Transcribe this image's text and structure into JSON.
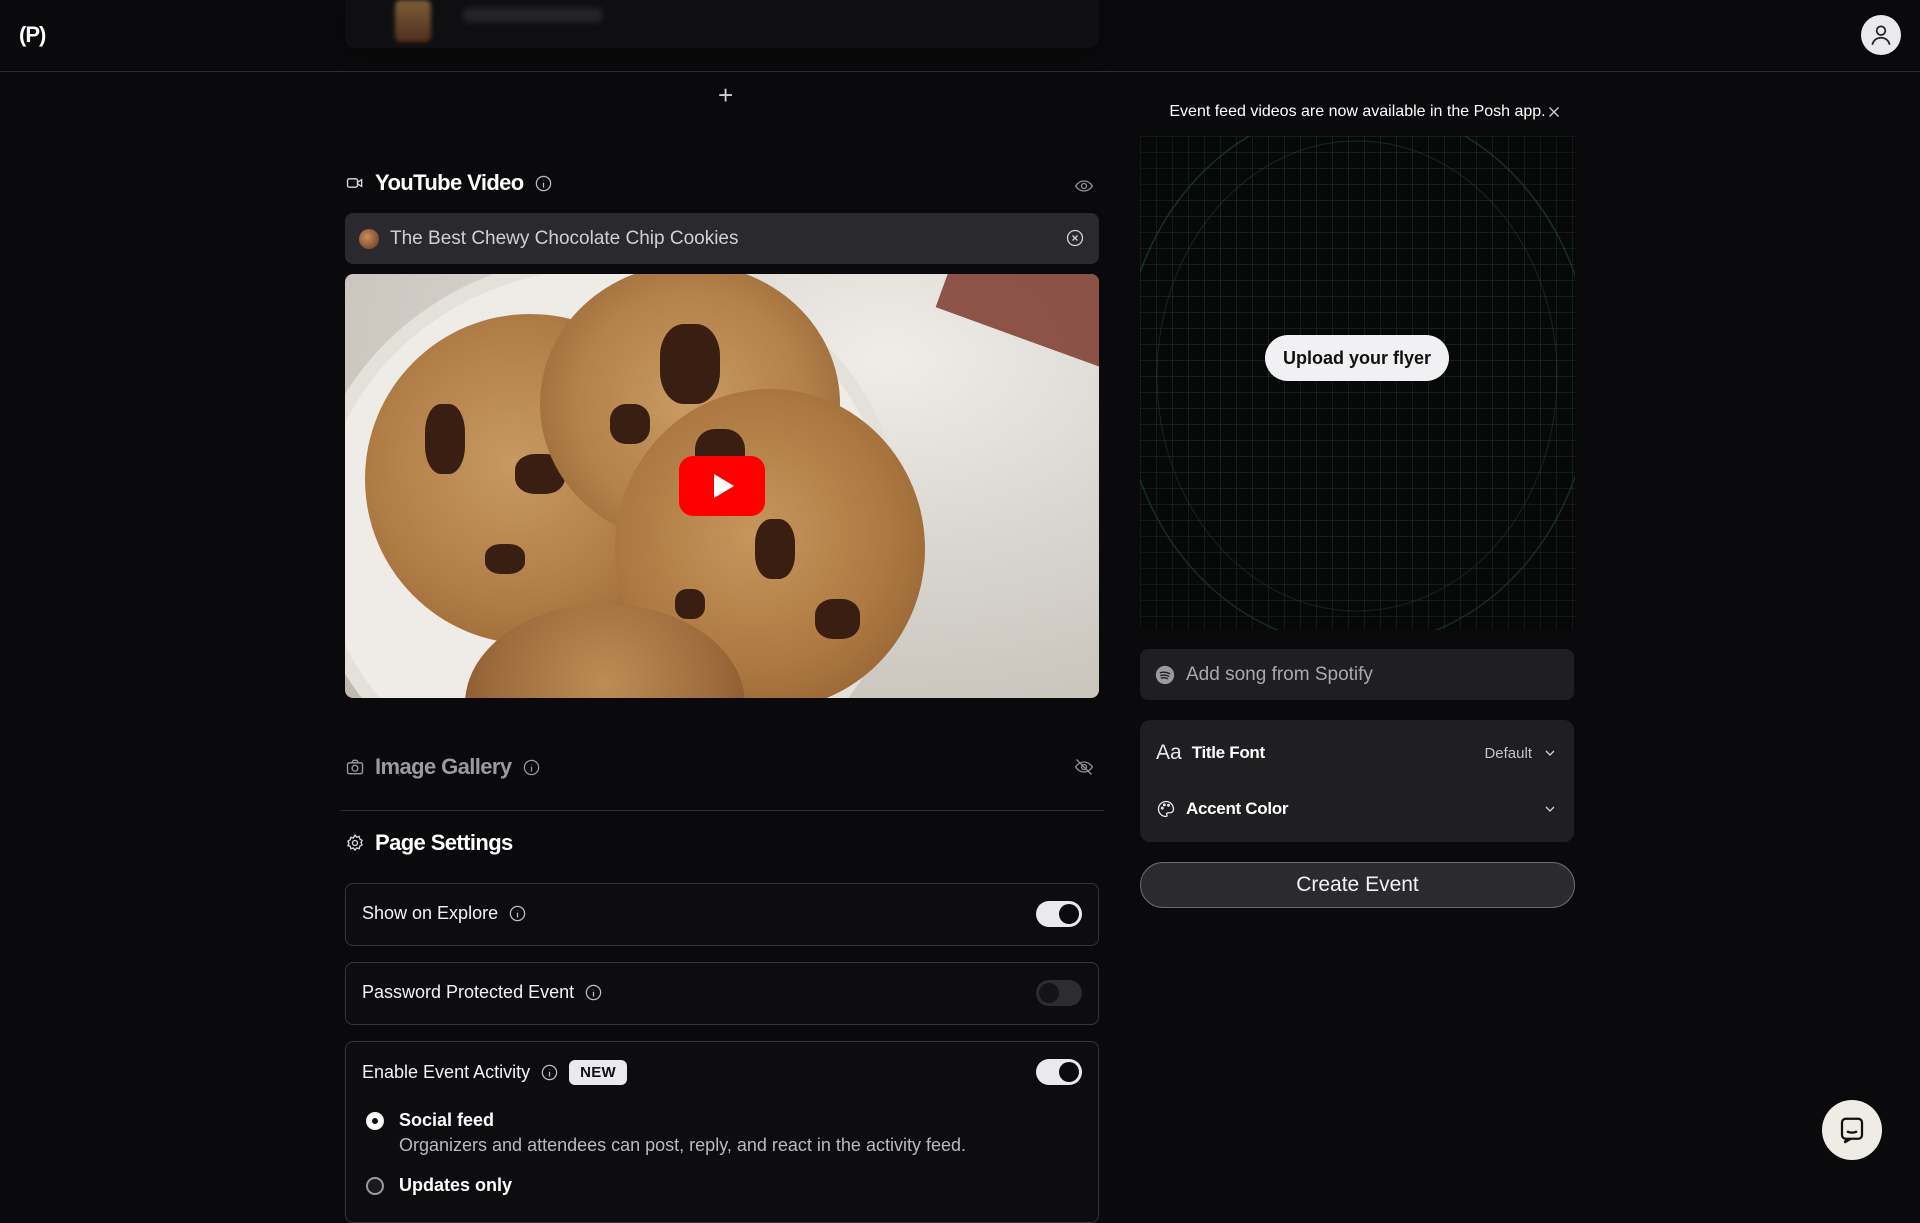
{
  "app": {
    "logo_text": "(P)"
  },
  "header": {
    "avatar_icon": "user-icon"
  },
  "youtube": {
    "title": "YouTube Video",
    "input_value": "The Best Chewy Chocolate Chip Cookies",
    "icons": [
      "video-camera-icon",
      "info-icon",
      "eye-icon",
      "clear-icon",
      "play-icon"
    ]
  },
  "gallery": {
    "title": "Image Gallery",
    "icons": [
      "camera-icon",
      "info-icon",
      "eye-off-icon"
    ]
  },
  "page_settings": {
    "title": "Page Settings",
    "settings": [
      {
        "label": "Show on Explore",
        "enabled": true
      },
      {
        "label": "Password Protected Event",
        "enabled": false
      },
      {
        "label": "Enable Event Activity",
        "badge": "NEW",
        "enabled": true
      }
    ],
    "activity_options": [
      {
        "title": "Social feed",
        "description": "Organizers and attendees can post, reply, and react in the activity feed.",
        "selected": true
      },
      {
        "title": "Updates only",
        "selected": false
      }
    ]
  },
  "sidebar": {
    "notice": "Event feed videos are now available in the Posh app.",
    "upload_label": "Upload your flyer",
    "spotify_placeholder": "Add song from Spotify",
    "title_font": {
      "glyph": "Aa",
      "label": "Title Font",
      "value": "Default"
    },
    "accent_color": {
      "label": "Accent Color"
    },
    "create_label": "Create Event"
  },
  "colors": {
    "background": "#0a0a0c",
    "youtube_red": "#ff0000",
    "panel": "#1f1f22"
  }
}
